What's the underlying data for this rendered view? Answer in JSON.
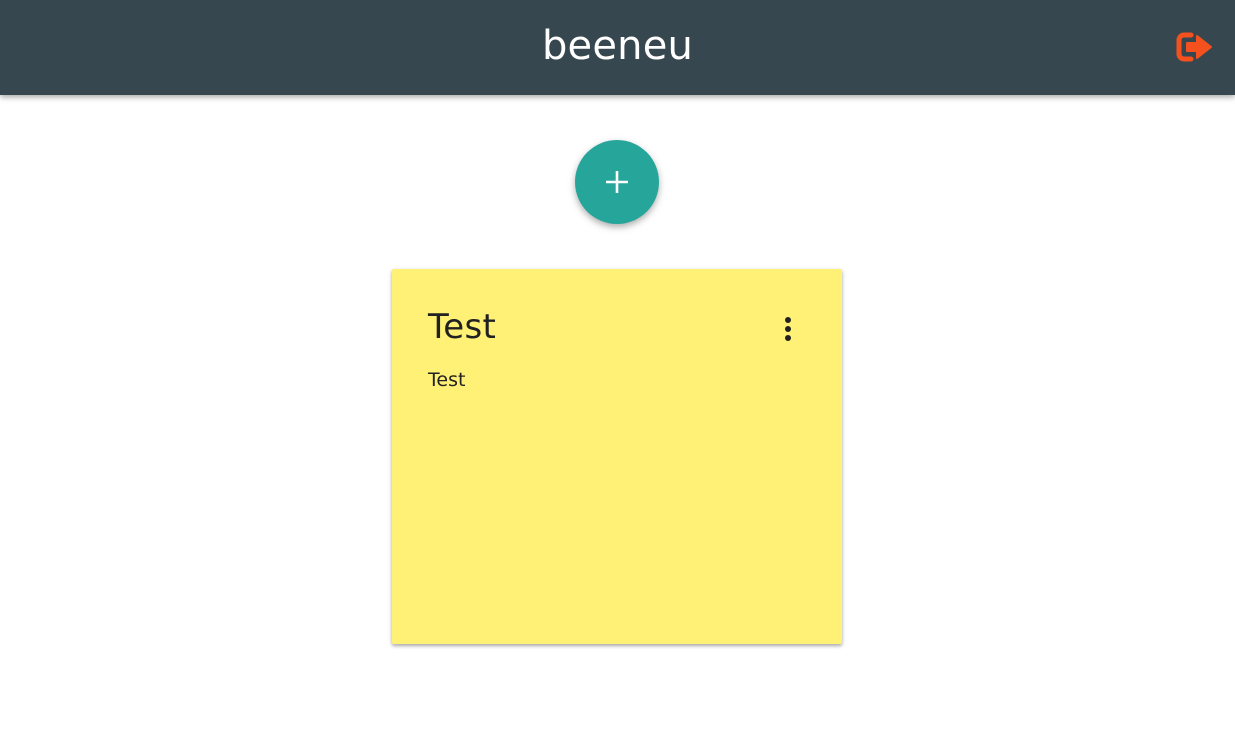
{
  "header": {
    "title": "beeneu",
    "logout_icon": "logout-icon",
    "background_color": "#37474f",
    "logout_color": "#f4511e"
  },
  "actions": {
    "add_icon": "plus-icon",
    "fab_color": "#26a69a"
  },
  "notes": [
    {
      "title": "Test",
      "body": "Test",
      "color": "#fff176",
      "menu_icon": "more-vert-icon"
    }
  ]
}
